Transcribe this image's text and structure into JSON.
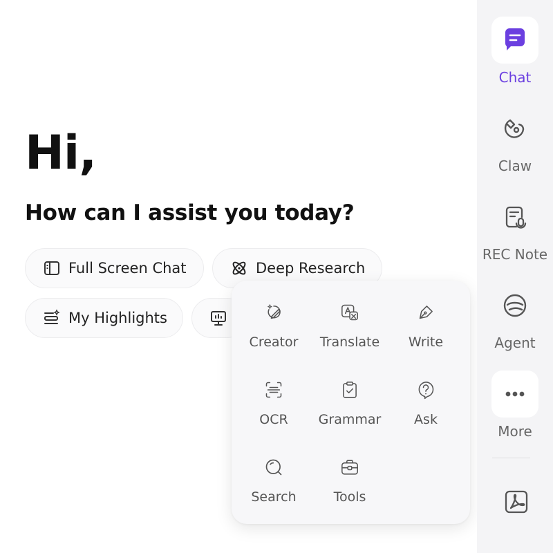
{
  "main": {
    "greeting": "Hi,",
    "subtitle": "How can I assist you today?",
    "chips": [
      {
        "label": "Full Screen Chat",
        "icon": "sidebar-layout-icon"
      },
      {
        "label": "Deep Research",
        "icon": "atom-icon"
      },
      {
        "label": "My Highlights",
        "icon": "highlights-list-icon"
      },
      {
        "label": "",
        "icon": "presentation-icon"
      }
    ]
  },
  "popup": {
    "tools": [
      {
        "label": "Creator",
        "icon": "creator-icon"
      },
      {
        "label": "Translate",
        "icon": "translate-icon"
      },
      {
        "label": "Write",
        "icon": "pen-icon"
      },
      {
        "label": "OCR",
        "icon": "scan-text-icon"
      },
      {
        "label": "Grammar",
        "icon": "clipboard-check-icon"
      },
      {
        "label": "Ask",
        "icon": "question-bubble-icon"
      },
      {
        "label": "Search",
        "icon": "search-icon"
      },
      {
        "label": "Tools",
        "icon": "toolbox-icon"
      }
    ]
  },
  "sidebar": {
    "items": [
      {
        "label": "Chat",
        "icon": "chat-icon",
        "active": true
      },
      {
        "label": "Claw",
        "icon": "claw-icon"
      },
      {
        "label": "REC Note",
        "icon": "rec-note-icon"
      },
      {
        "label": "Agent",
        "icon": "agent-icon"
      },
      {
        "label": "More",
        "icon": "more-dots-icon"
      }
    ],
    "extra_icon": "pdf-icon"
  },
  "colors": {
    "accent": "#6b3fe0",
    "icon_gray": "#555555",
    "sidebar_bg": "#f4f4f6"
  }
}
